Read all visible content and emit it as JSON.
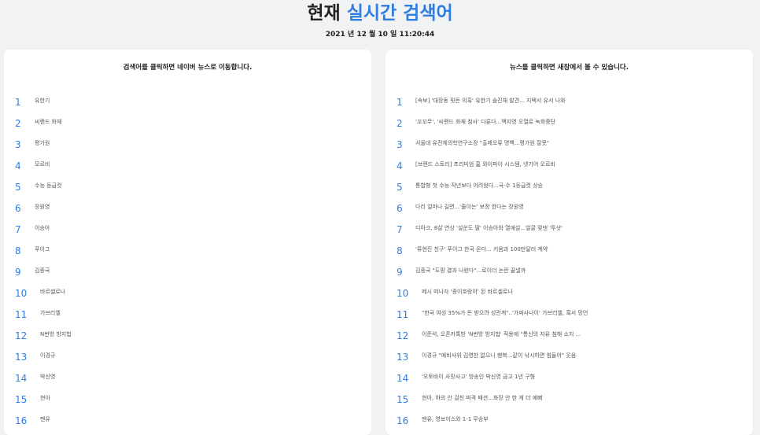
{
  "header": {
    "title_prefix": "현재",
    "title_accent": "실시간 검색어",
    "datetime": "2021 년 12 월 10 일 11:20:44",
    "accent_color": "#2f7de1"
  },
  "left_panel": {
    "heading": "검색어를 클릭하면 네이버 뉴스로 이동합니다.",
    "items": [
      {
        "rank": "1",
        "keyword": "유한기"
      },
      {
        "rank": "2",
        "keyword": "씨랜드 화재"
      },
      {
        "rank": "3",
        "keyword": "평가원"
      },
      {
        "rank": "4",
        "keyword": "모르비"
      },
      {
        "rank": "5",
        "keyword": "수능 등급컷"
      },
      {
        "rank": "6",
        "keyword": "장원영"
      },
      {
        "rank": "7",
        "keyword": "이승아"
      },
      {
        "rank": "8",
        "keyword": "푸이그"
      },
      {
        "rank": "9",
        "keyword": "김종국"
      },
      {
        "rank": "10",
        "keyword": "바르셀로나"
      },
      {
        "rank": "11",
        "keyword": "가브리엘"
      },
      {
        "rank": "12",
        "keyword": "N번방 방지법"
      },
      {
        "rank": "13",
        "keyword": "이경규"
      },
      {
        "rank": "14",
        "keyword": "박신영"
      },
      {
        "rank": "15",
        "keyword": "현아"
      },
      {
        "rank": "16",
        "keyword": "맨유"
      }
    ]
  },
  "right_panel": {
    "heading": "뉴스를 클릭하면 새창에서 볼 수 있습니다.",
    "items": [
      {
        "rank": "1",
        "headline": "[속보] '대장동 핏돈 의혹' 유한기 숨진채 발견... 지택서 유서 나와"
      },
      {
        "rank": "2",
        "headline": "'꼬꼬무', '씨랜드 화재 참사' 다룬다...백지영 오열로 녹화중단"
      },
      {
        "rank": "3",
        "headline": "서울대 유전체의학연구소장 \"출제오류 명백...평가원 잘못\""
      },
      {
        "rank": "4",
        "headline": "[브랜드 스토리] 프리미엄 홈 와이파이 시스템, 넷기어 오르비"
      },
      {
        "rank": "5",
        "headline": "통합형 첫 수능 작년보다 어려웠다...국·수 1등급컷 상승"
      },
      {
        "rank": "6",
        "headline": "다리 얼마나 길면...'줄이는' 보정 한다는 장원영"
      },
      {
        "rank": "7",
        "headline": "디아크, 8살 연상 '설운도 딸' 이승아와 열애설...얼굴 맞댄 '투샷'"
      },
      {
        "rank": "8",
        "headline": "'류현진 친구' 푸이그 한국 온다... 키움과 100만달러 계약"
      },
      {
        "rank": "9",
        "headline": "김종국 \"도핑 결과 나왔다\"...로이더 논란 끝낼까"
      },
      {
        "rank": "10",
        "headline": "메시 떠나자 '종이호랑이' 된 바르셀로나"
      },
      {
        "rank": "11",
        "headline": "\"한국 여성 35%가 돈 받으려 성관계\"..'가짜사나이' 가브리엘, 흑서 망언"
      },
      {
        "rank": "12",
        "headline": "이준석, 오픈카톡방 'N번방 방지법' 적용에 \"통신의 자유 침해 소지 ..."
      },
      {
        "rank": "13",
        "headline": "이경규 \"예비사위 김영찬 없으니 행복...같이 낚시하면 힘들어\" 웃음"
      },
      {
        "rank": "14",
        "headline": "'오토바이 사망사고' 방송인 박신영 금고 1년 구형"
      },
      {
        "rank": "15",
        "headline": "현아, 하의 안 걸친 파격 패션...화장 안 한 게 더 예뻐"
      },
      {
        "rank": "16",
        "headline": "맨유, 영보이스와 1-1 무승부"
      }
    ]
  }
}
